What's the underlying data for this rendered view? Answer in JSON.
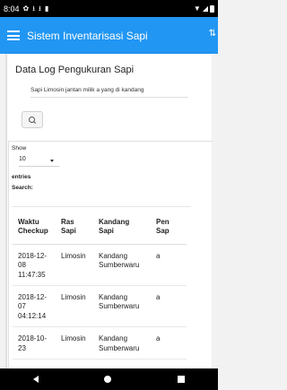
{
  "status_bar": {
    "time": "8:04",
    "left_icons": [
      "gear-icon",
      "download-icon",
      "download-icon",
      "sd-card-icon"
    ],
    "right_icons": [
      "wifi-icon",
      "signal-icon",
      "battery-icon"
    ]
  },
  "app_bar": {
    "title": "Sistem Inventarisasi Sapi",
    "background": "#2196f3"
  },
  "page": {
    "title": "Data Log Pengukuran Sapi",
    "subtitle": "Sapi Limosin jantan milik a yang di kandang"
  },
  "table_controls": {
    "show_label": "Show",
    "entries_value": "10",
    "entries_label": "entries",
    "search_label": "Search:"
  },
  "table": {
    "headers": [
      [
        "Waktu",
        "Checkup"
      ],
      [
        "Ras",
        "Sapi"
      ],
      [
        "Kandang",
        "Sapi"
      ],
      [
        "Pen",
        "Sap"
      ]
    ],
    "rows": [
      {
        "waktu": [
          "2018-12-",
          "08",
          "11:47:35"
        ],
        "ras": "Limosin",
        "kandang": [
          "Kandang",
          "Sumberwaru"
        ],
        "pemilik": "a"
      },
      {
        "waktu": [
          "2018-12-",
          "07",
          "04:12:14"
        ],
        "ras": "Limosin",
        "kandang": [
          "Kandang",
          "Sumberwaru"
        ],
        "pemilik": "a"
      },
      {
        "waktu": [
          "2018-10-",
          "23",
          ""
        ],
        "ras": "Limosin",
        "kandang": [
          "Kandang",
          "Sumberwaru"
        ],
        "pemilik": "a"
      }
    ]
  }
}
